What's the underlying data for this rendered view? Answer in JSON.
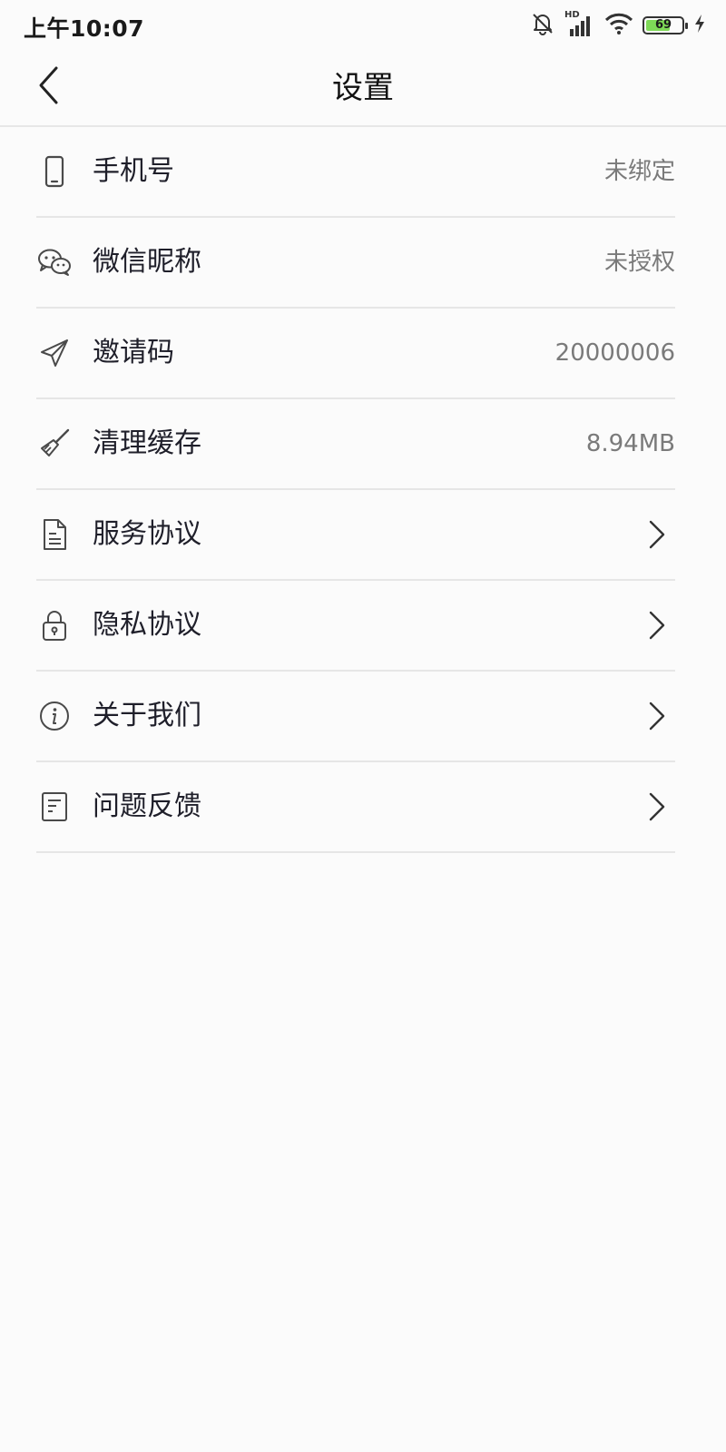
{
  "status_bar": {
    "time": "上午10:07",
    "battery_percent": 69,
    "battery_label": "69",
    "hd_label": "HD",
    "icons": [
      "mute-bell-icon",
      "signal-icon",
      "wifi-icon",
      "battery-icon",
      "charging-icon"
    ]
  },
  "nav": {
    "title": "设置",
    "back_icon": "back-chevron-icon"
  },
  "settings": {
    "items": [
      {
        "icon": "phone-icon",
        "label": "手机号",
        "value": "未绑定"
      },
      {
        "icon": "wechat-icon",
        "label": "微信昵称",
        "value": "未授权"
      },
      {
        "icon": "paper-plane-icon",
        "label": "邀请码",
        "value": "20000006"
      },
      {
        "icon": "broom-icon",
        "label": "清理缓存",
        "value": "8.94MB"
      },
      {
        "icon": "document-icon",
        "label": "服务协议",
        "value": ""
      },
      {
        "icon": "lock-icon",
        "label": "隐私协议",
        "value": ""
      },
      {
        "icon": "info-icon",
        "label": "关于我们",
        "value": ""
      },
      {
        "icon": "feedback-icon",
        "label": "问题反馈",
        "value": ""
      }
    ]
  },
  "colors": {
    "background": "#fbfbfb",
    "divider": "#e6e6e6",
    "label": "#1f1f2a",
    "value": "#7a7a7a",
    "battery_fill": "#7ed957"
  }
}
